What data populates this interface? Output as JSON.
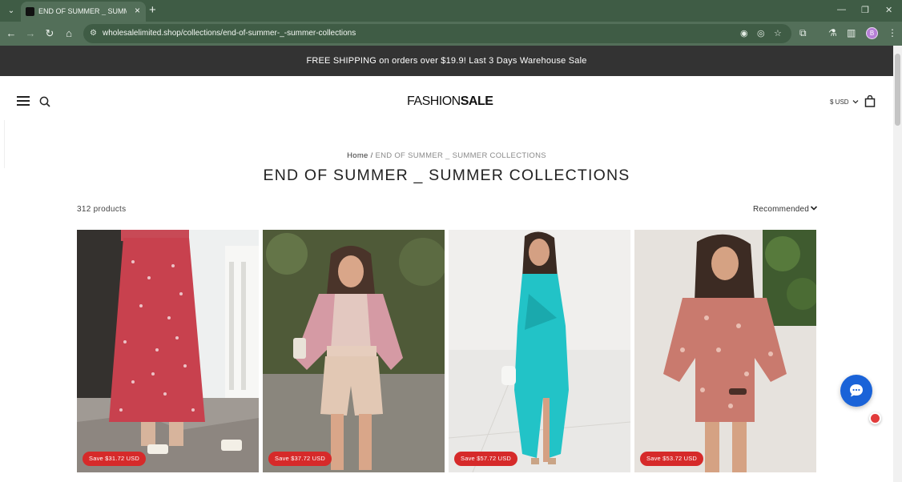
{
  "browser": {
    "tab_title": "END OF SUMMER _ SUMMER C",
    "url": "wholesalelimited.shop/collections/end-of-summer-_-summer-collections",
    "profile_initial": "B"
  },
  "announcement": "FREE SHIPPING on orders over $19.9! Last 3 Days Warehouse Sale",
  "header": {
    "logo_thin": "FASHION",
    "logo_bold": "SALE",
    "currency": "$ USD"
  },
  "breadcrumb": {
    "home": "Home",
    "separator": " / ",
    "current": "END OF SUMMER _ SUMMER COLLECTIONS"
  },
  "collection": {
    "title": "END OF SUMMER _ SUMMER COLLECTIONS",
    "count": "312 products",
    "sort_label": "Recommended"
  },
  "products": [
    {
      "badge": "Save $31.72 USD",
      "image": "floral-maxi-skirt"
    },
    {
      "badge": "Save $37.72 USD",
      "image": "boho-blouse-shorts"
    },
    {
      "badge": "Save $57.72 USD",
      "image": "turquoise-wrap-dress"
    },
    {
      "badge": "Save $53.72 USD",
      "image": "paisley-romper"
    }
  ],
  "colors": {
    "browser_dark": "#3f5c45",
    "browser_toolbar": "#536f59",
    "announcement_bg": "#333333",
    "badge_red": "#d62a2a",
    "chat_blue": "#1a63d8"
  }
}
